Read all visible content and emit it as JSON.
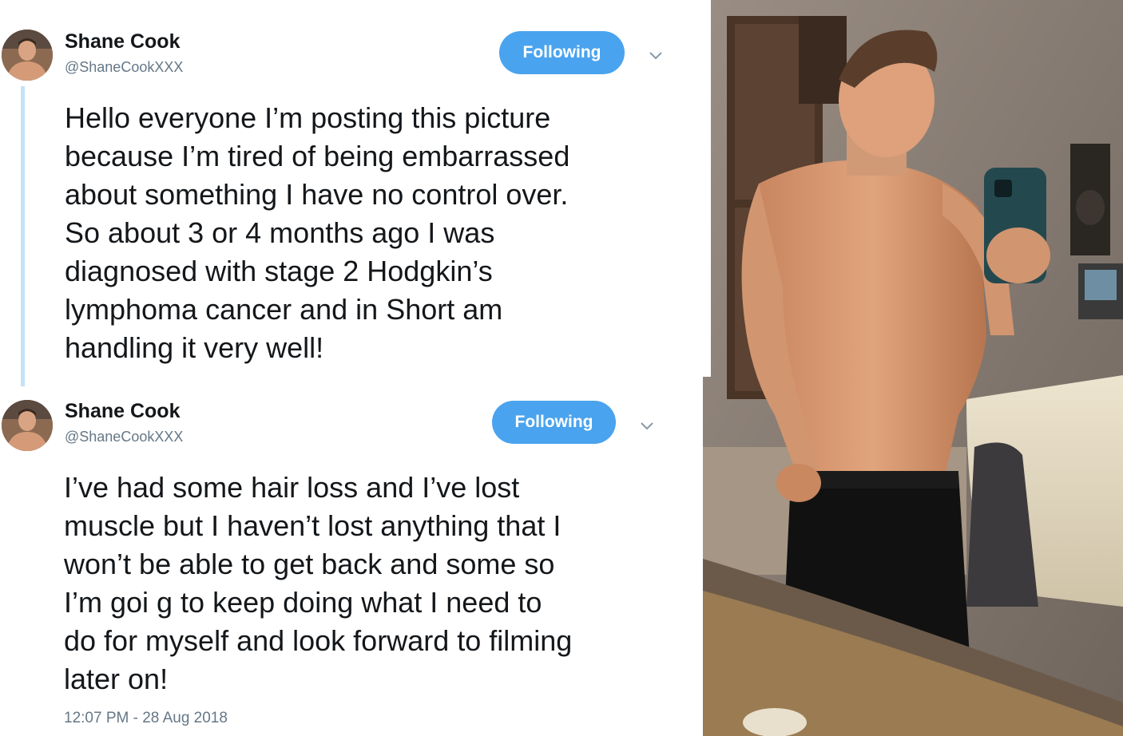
{
  "tweets": [
    {
      "name": "Shane Cook",
      "handle": "@ShaneCookXXX",
      "follow_label": "Following",
      "text_lines": [
        "Hello everyone I’m posting this picture",
        "because I’m tired of being embarrassed",
        "about something I have no control over.",
        "So about 3 or 4 months ago I was",
        "diagnosed with stage 2 Hodgkin’s",
        "lymphoma cancer and in Short am",
        "handling it very well!"
      ]
    },
    {
      "name": "Shane Cook",
      "handle": "@ShaneCookXXX",
      "follow_label": "Following",
      "text_lines": [
        "I’ve had some hair loss and I’ve lost",
        "muscle but I haven’t lost anything that I",
        "won’t be able to get back and some so",
        "I’m goi g to keep doing what I need to",
        "do for myself and look forward to filming",
        "later on!"
      ],
      "timestamp": "12:07 PM - 28 Aug 2018"
    }
  ],
  "colors": {
    "accent": "#4aa3ee",
    "thread_line": "#c4e1f7",
    "secondary_text": "#657786",
    "primary_text": "#14171a"
  },
  "icons": [
    "chevron-down-icon"
  ]
}
